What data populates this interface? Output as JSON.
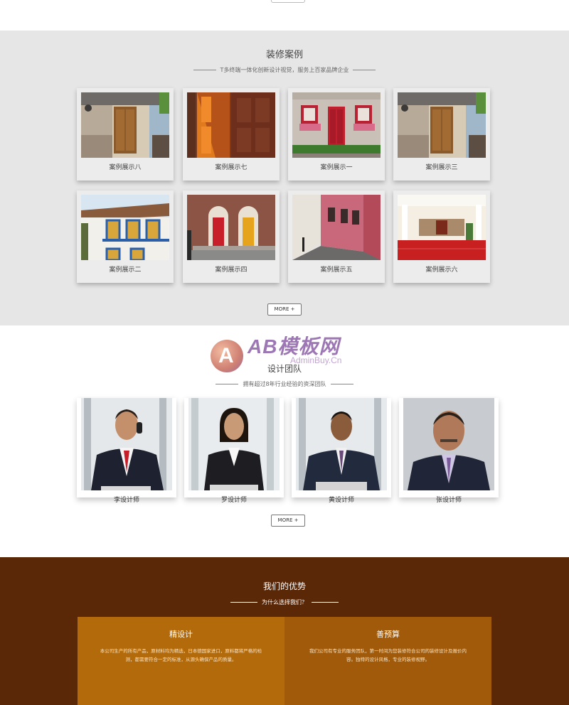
{
  "cases": {
    "title": "装修案例",
    "subtitle": "T多终端一体化创新设计视觉，服务上百家品牌企业",
    "items": [
      {
        "caption": "案例展示八"
      },
      {
        "caption": "案例展示七"
      },
      {
        "caption": "案例展示一"
      },
      {
        "caption": "案例展示三"
      },
      {
        "caption": "案例展示二"
      },
      {
        "caption": "案例展示四"
      },
      {
        "caption": "案例展示五"
      },
      {
        "caption": "案例展示六"
      }
    ],
    "more_label": "MORE +"
  },
  "watermark": {
    "logo_letter": "A",
    "brand": "AB模板网",
    "url": "AdminBuy.Cn"
  },
  "team": {
    "title": "设计团队",
    "subtitle": "拥有超过8年行业经验的资深团队",
    "members": [
      {
        "name": "李设计师"
      },
      {
        "name": "罗设计师"
      },
      {
        "name": "黄设计师"
      },
      {
        "name": "张设计师"
      }
    ],
    "more_label": "MORE +"
  },
  "advantages": {
    "title": "我们的优势",
    "subtitle": "为什么选择我们？",
    "boxes": [
      {
        "heading": "精设计",
        "text": "本公司生产的所有产品，原材料均为精选，日本德国家进口，原料都将严格的检测，都需要符合一定的标准，从源头确保产品的质量。",
        "color": "#b26a0a"
      },
      {
        "heading": "善预算",
        "text": "我们公司有专业的服务团队，第一时间为您装修符合公司的装修设计及报价内容。独特的设计风格，专业的装修视野。",
        "color": "#a05a09"
      }
    ]
  }
}
